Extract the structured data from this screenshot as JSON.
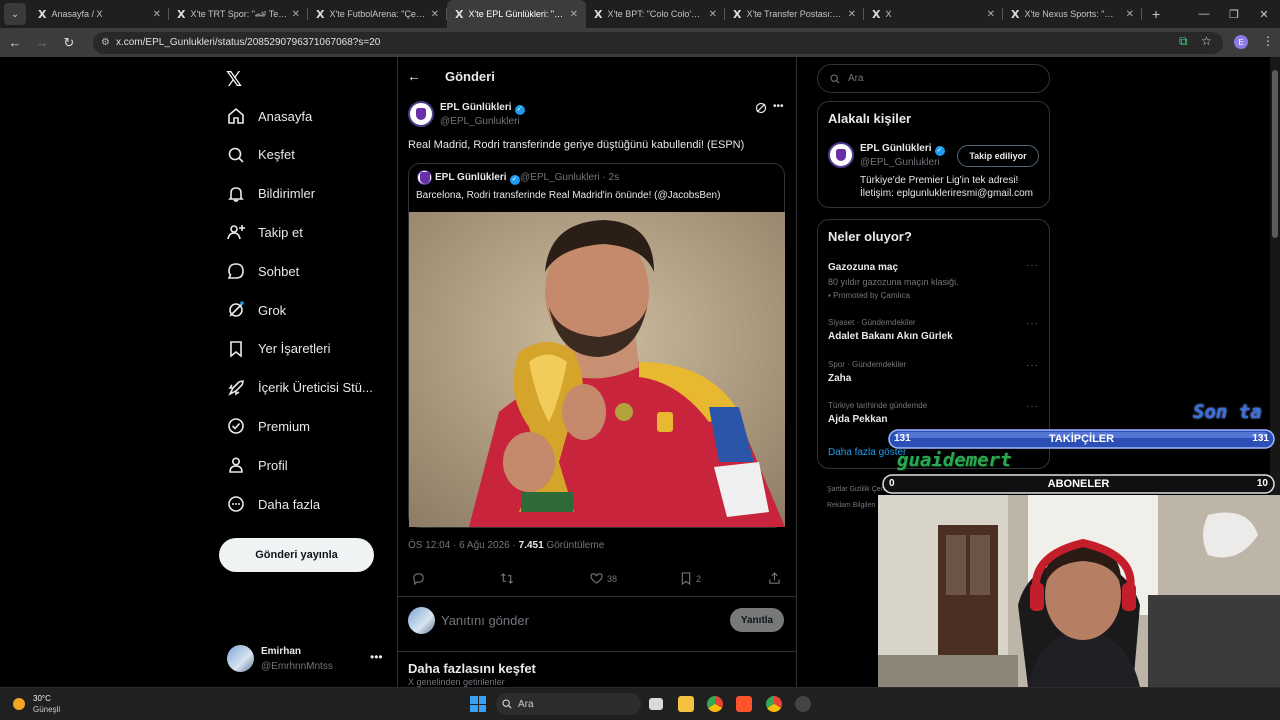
{
  "browser": {
    "tabs": [
      {
        "label": "Anasayfa / X",
        "active": false
      },
      {
        "label": "X'te TRT Spor: \"🏎 Temsil",
        "active": false
      },
      {
        "label": "X'te FutbolArena: \"Çekya",
        "active": false
      },
      {
        "label": "X'te EPL Günlükleri: \"Real",
        "active": true
      },
      {
        "label": "X'te BPT: \"Colo Colo'ya tr",
        "active": false
      },
      {
        "label": "X'te Transfer Postası: \"🔴",
        "active": false
      },
      {
        "label": "X",
        "active": false
      },
      {
        "label": "X'te Nexus Sports: \"🚨 Fr",
        "active": false
      }
    ],
    "url": "x.com/EPL_Gunlukleri/status/2085290796371067068?s=20",
    "profile_initial": "E"
  },
  "nav": {
    "items": [
      {
        "label": "Anasayfa",
        "icon": "home-icon"
      },
      {
        "label": "Keşfet",
        "icon": "search-icon"
      },
      {
        "label": "Bildirimler",
        "icon": "bell-icon"
      },
      {
        "label": "Takip et",
        "icon": "person-add-icon"
      },
      {
        "label": "Sohbet",
        "icon": "chat-icon"
      },
      {
        "label": "Grok",
        "icon": "grok-icon"
      },
      {
        "label": "Yer İşaretleri",
        "icon": "bookmark-icon"
      },
      {
        "label": "İçerik Üreticisi Stü...",
        "icon": "rocket-icon"
      },
      {
        "label": "Premium",
        "icon": "premium-icon"
      },
      {
        "label": "Profil",
        "icon": "profile-icon"
      },
      {
        "label": "Daha fazla",
        "icon": "more-circle-icon"
      }
    ],
    "post_button": "Gönderi yayınla",
    "user": {
      "name": "Emirhan",
      "handle": "@EmrhnnMntss"
    }
  },
  "post": {
    "header_title": "Gönderi",
    "author_name": "EPL Günlükleri",
    "author_handle": "@EPL_Gunlukleri",
    "text": "Real Madrid, Rodri transferinde geriye düştüğünü kabullendi! (ESPN)",
    "quote": {
      "author_name": "EPL Günlükleri",
      "author_handle": "@EPL_Gunlukleri · 2s",
      "text": "Barcelona, Rodri transferinde Real Madrid'in önünde! (@JacobsBen)"
    },
    "time": "ÖS 12:04 · 6 Ağu 2026 ·",
    "views_count": "7.451",
    "views_label": "Görüntüleme",
    "likes": "38",
    "bookmarks": "2",
    "reply_placeholder": "Yanıtını gönder",
    "reply_button": "Yanıtla",
    "discover_title": "Daha fazlasını keşfet",
    "discover_sub": "X genelinden getirilenler"
  },
  "sidebar": {
    "search_placeholder": "Ara",
    "related_title": "Alakalı kişiler",
    "related": {
      "name": "EPL Günlükleri",
      "handle": "@EPL_Gunlukleri",
      "follow_label": "Takip ediliyor",
      "bio_line1": "Türkiye'de Premier Lig'in tek adresi!",
      "bio_line2": "İletişim: eplgunlukleriresmi@gmail.com"
    },
    "trends_title": "Neler oluyor?",
    "trends": [
      {
        "category": "",
        "title": "Gazozuna maç",
        "sub": "80 yıldır gazozuna maçın klasiği.",
        "promo": "Promoted by Çamlıca"
      },
      {
        "category": "Siyaset · Gündemdekiler",
        "title": "Adalet Bakanı Akın Gürlek",
        "sub": "",
        "promo": ""
      },
      {
        "category": "Spor · Gündemdekiler",
        "title": "Zaha",
        "sub": "",
        "promo": ""
      },
      {
        "category": "Türkiye tarihinde gündemde",
        "title": "Ajda Pekkan",
        "sub": "",
        "promo": ""
      }
    ],
    "show_more": "Daha fazla göster",
    "footer1": "Şartlar   Gizlilik   Çerezler   Erişilebilirlik",
    "footer2": "Reklam Bilgileri"
  },
  "overlay": {
    "son_text": "Son ta",
    "followers_left": "131",
    "followers_label": "TAKİPÇİLER",
    "followers_right": "131",
    "guaide": "guaidemert",
    "subs_left": "0",
    "subs_label": "ABONELER",
    "subs_right": "10"
  },
  "taskbar": {
    "temp": "30°C",
    "weather": "Güneşli",
    "search": "Ara"
  }
}
